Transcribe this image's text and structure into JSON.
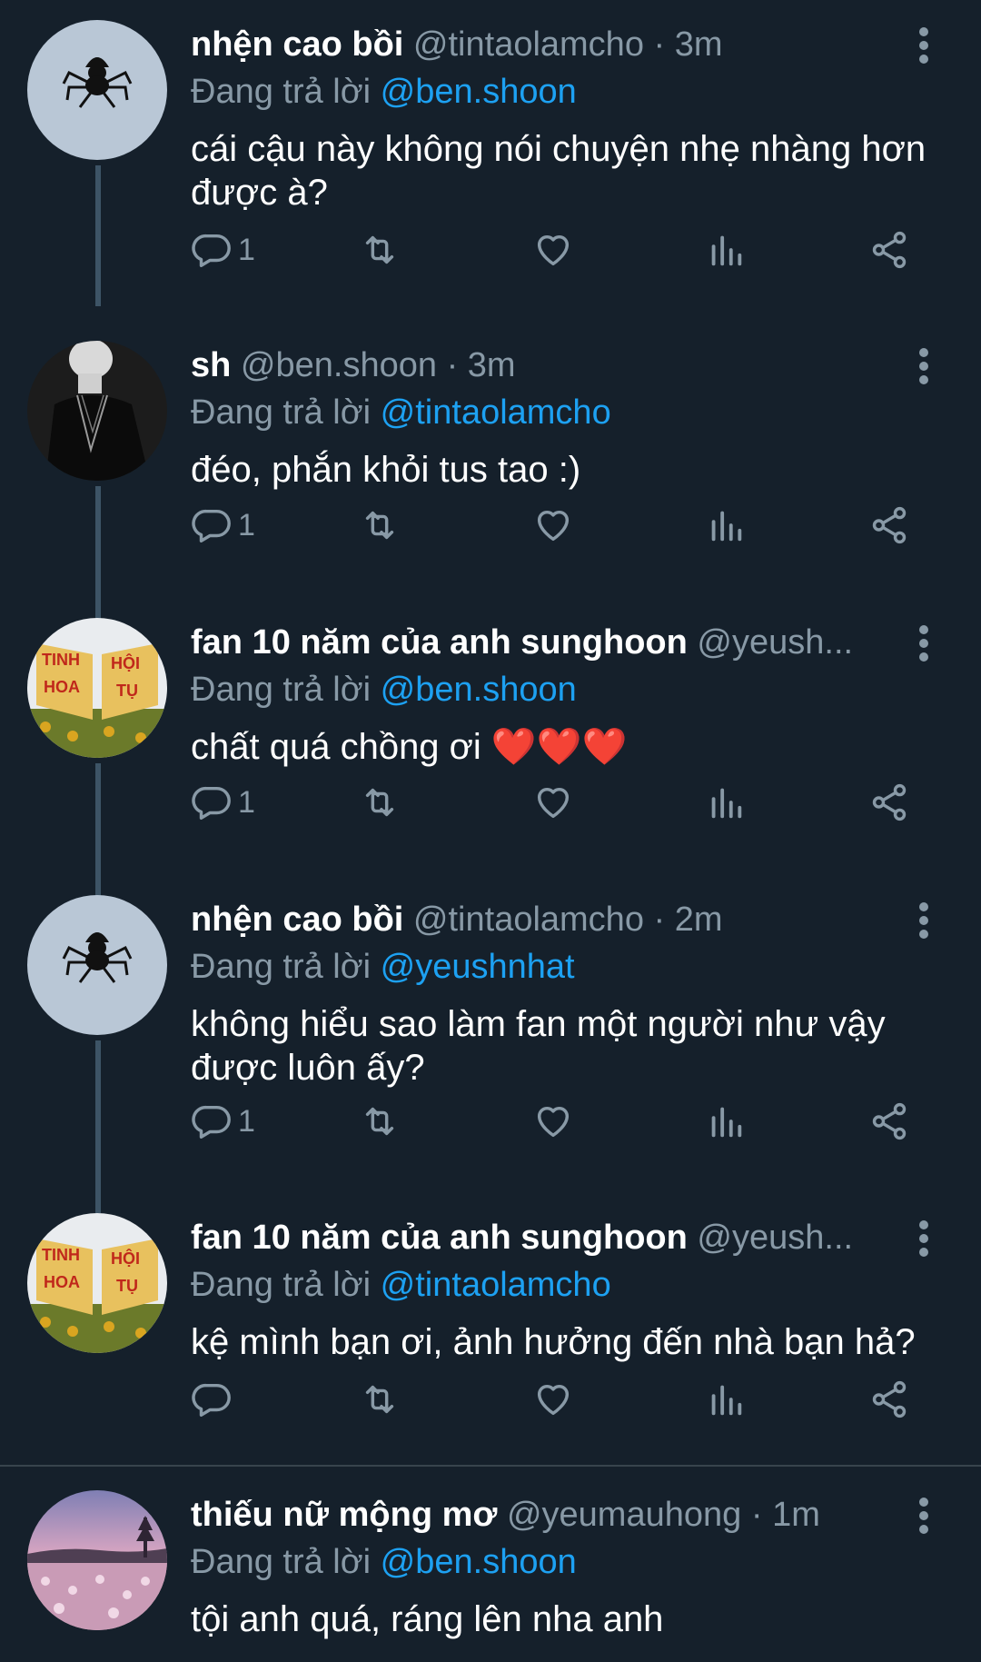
{
  "tweets": [
    {
      "name": "nhện cao bồi",
      "handle": "@tintaolamcho",
      "time": "3m",
      "reply_prefix": "Đang trả lời",
      "reply_to": "@ben.shoon",
      "text": "cái cậu này không nói chuyện nhẹ nhàng hơn được à?",
      "reply_count": "1",
      "avatar": "spider-cowboy"
    },
    {
      "name": "sh",
      "handle": "@ben.shoon",
      "time": "3m",
      "reply_prefix": "Đang trả lời",
      "reply_to": "@tintaolamcho",
      "text": "đéo, phắn khỏi tus tao :)",
      "reply_count": "1",
      "avatar": "dark-person"
    },
    {
      "name": "fan 10 năm của anh sunghoon",
      "handle": "@yeush...",
      "time": "",
      "reply_prefix": "Đang trả lời",
      "reply_to": "@ben.shoon",
      "text": "chất quá chồng ơi ❤️❤️❤️",
      "reply_count": "1",
      "avatar": "tinh-hoa-hoi-tu",
      "avatar_text": [
        "TINH",
        "HOA",
        "HỘI",
        "TỤ"
      ]
    },
    {
      "name": "nhện cao bồi",
      "handle": "@tintaolamcho",
      "time": "2m",
      "reply_prefix": "Đang trả lời",
      "reply_to": "@yeushnhat",
      "text": "không hiểu sao làm fan một người như vậy được luôn ấy?",
      "reply_count": "1",
      "avatar": "spider-cowboy"
    },
    {
      "name": "fan 10 năm của anh sunghoon",
      "handle": "@yeush...",
      "time": "",
      "reply_prefix": "Đang trả lời",
      "reply_to": "@tintaolamcho",
      "text": "kệ mình bạn ơi, ảnh hưởng đến nhà bạn hả?",
      "reply_count": "",
      "avatar": "tinh-hoa-hoi-tu",
      "avatar_text": [
        "TINH",
        "HOA",
        "HỘI",
        "TỤ"
      ]
    },
    {
      "name": "thiếu nữ mộng mơ",
      "handle": "@yeumauhong",
      "time": "1m",
      "reply_prefix": "Đang trả lời",
      "reply_to": "@ben.shoon",
      "text": "tội anh quá, ráng lên nha anh",
      "reply_count": "",
      "avatar": "pink-flower-field"
    }
  ],
  "icons": [
    "reply-icon",
    "retweet-icon",
    "like-icon",
    "analytics-icon",
    "share-icon",
    "more-icon"
  ],
  "colors": {
    "background": "#15202b",
    "muted": "#8899a6",
    "mention": "#1da1f2",
    "thread_line": "#3d5466"
  }
}
